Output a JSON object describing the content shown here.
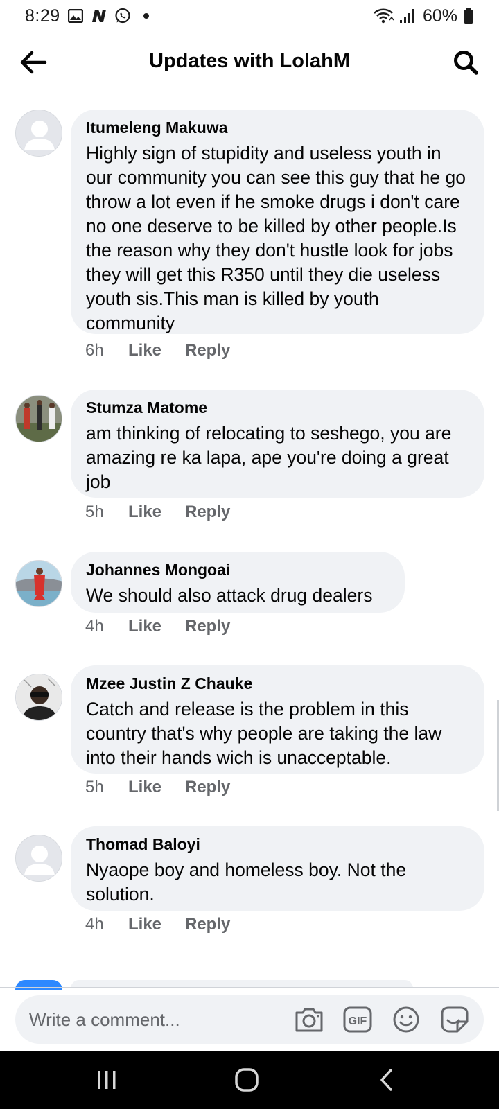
{
  "status_bar": {
    "time": "8:29",
    "battery_percent": "60%",
    "icons": [
      "gallery-icon",
      "n-app-icon",
      "whatsapp-icon",
      "notification-dot-icon",
      "wifi-icon",
      "signal-icon",
      "battery-icon"
    ]
  },
  "header": {
    "title": "Updates with LolahM",
    "back_icon": "arrow-left-icon",
    "search_icon": "search-icon"
  },
  "comments": [
    {
      "author": "Itumeleng Makuwa",
      "text": "Highly sign of stupidity and useless youth in our community you can see this guy that he go throw a lot even if he smoke drugs i don't care no one deserve to be killed by other people.Is the reason why they don't hustle look for jobs they will get this R350 until they die useless youth sis.This man is killed by youth community",
      "time": "6h",
      "like": "Like",
      "reply": "Reply"
    },
    {
      "author": "Stumza Matome",
      "text": "am thinking of relocating to seshego, you are amazing re ka lapa, ape you're doing a great job",
      "time": "5h",
      "like": "Like",
      "reply": "Reply"
    },
    {
      "author": "Johannes Mongoai",
      "text": "We should also attack drug dealers",
      "time": "4h",
      "like": "Like",
      "reply": "Reply"
    },
    {
      "author": "Mzee Justin Z Chauke",
      "text": "Catch and release is the problem in this country that's why people are taking the law into their hands wich is unacceptable.",
      "time": "5h",
      "like": "Like",
      "reply": "Reply"
    },
    {
      "author": "Thomad Baloyi",
      "text": "Nyaope boy and homeless boy. Not the solution.",
      "time": "4h",
      "like": "Like",
      "reply": "Reply"
    }
  ],
  "composer": {
    "placeholder": "Write a comment...",
    "icons": [
      "camera-icon",
      "gif-icon",
      "emoji-icon",
      "sticker-icon"
    ],
    "gif_label": "GIF"
  },
  "nav_bar": {
    "icons": [
      "recent-apps-icon",
      "home-icon",
      "back-icon"
    ]
  },
  "colors": {
    "bubble": "#f0f2f5",
    "meta_text": "#65676b",
    "text": "#050505",
    "default_avatar": "#bcc0c4"
  }
}
